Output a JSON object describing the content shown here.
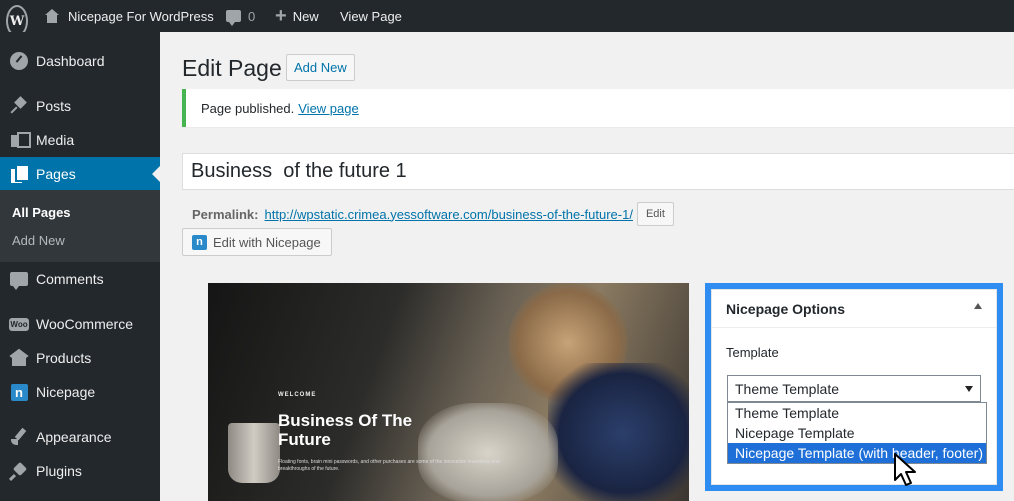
{
  "admin_bar": {
    "logo_glyph": "W",
    "site_name": "Nicepage For WordPress",
    "comments_count": "0",
    "new_label": "New",
    "view_page_label": "View Page"
  },
  "sidebar": {
    "items": [
      {
        "label": "Dashboard",
        "icon": "dashboard-gauge-icon"
      },
      {
        "label": "Posts",
        "icon": "pushpin-icon"
      },
      {
        "label": "Media",
        "icon": "media-icon"
      },
      {
        "label": "Pages",
        "icon": "pages-icon"
      },
      {
        "label": "Comments",
        "icon": "comment-icon"
      },
      {
        "label": "WooCommerce",
        "icon": "woocommerce-icon"
      },
      {
        "label": "Products",
        "icon": "box-icon"
      },
      {
        "label": "Nicepage",
        "icon": "nicepage-icon"
      },
      {
        "label": "Appearance",
        "icon": "paintbrush-icon"
      },
      {
        "label": "Plugins",
        "icon": "plug-icon"
      }
    ],
    "submenu": [
      "All Pages",
      "Add New"
    ],
    "woo_glyph": "Woo",
    "np_glyph": "n"
  },
  "main": {
    "title": "Edit Page",
    "add_new_label": "Add New",
    "notice_text": "Page published.",
    "notice_link": "View page",
    "post_title_value": "Business  of the future 1",
    "permalink_label": "Permalink:",
    "permalink_url": "http://wpstatic.crimea.yessoftware.com/business-of-the-future-1/",
    "permalink_edit_label": "Edit",
    "edit_with_nicepage_label": "Edit with Nicepage",
    "np_glyph": "n"
  },
  "preview": {
    "welcome": "WELCOME",
    "title": "Business Of The Future",
    "body": "Floating fonts, brain mini passwords, and other purchases are some of the innovative inventions and breakthroughs of the future."
  },
  "nicepage_options": {
    "title": "Nicepage Options",
    "template_label": "Template",
    "selected": "Theme Template",
    "options": [
      "Theme Template",
      "Nicepage Template",
      "Nicepage Template (with header, footer)"
    ],
    "highlighted_index": 2
  },
  "colors": {
    "admin_bg": "#23282d",
    "accent": "#0073aa",
    "notice_success": "#46b450",
    "highlight_outline": "#2f8cf0",
    "dropdown_highlight": "#1e70d8"
  }
}
